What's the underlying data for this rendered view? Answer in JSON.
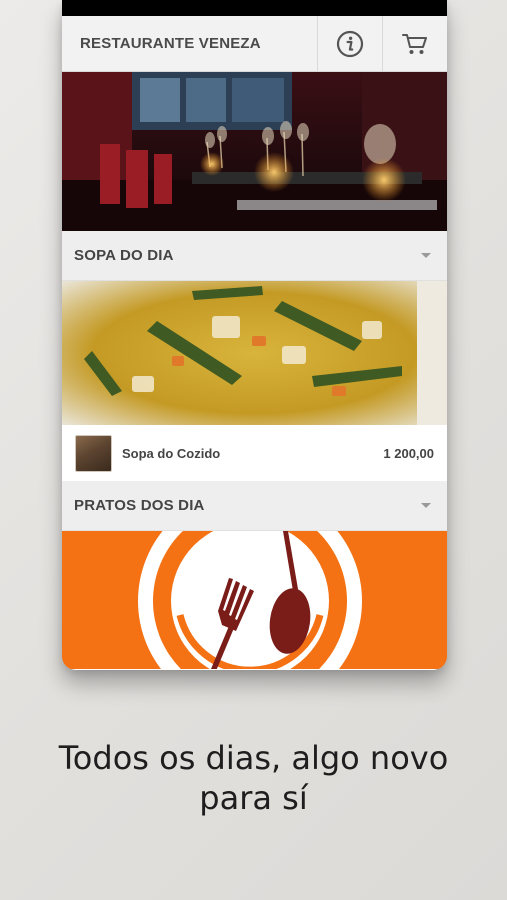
{
  "app": {
    "title": "RESTAURANTE VENEZA",
    "info_icon": "info-icon",
    "cart_icon": "cart-icon"
  },
  "sections": [
    {
      "title": "SOPA DO DIA",
      "items": [
        {
          "name": "Sopa do Cozido",
          "price": "1 200,00"
        }
      ]
    },
    {
      "title": "PRATOS DOS DIA"
    }
  ],
  "tagline": {
    "line1": "Todos os dias, algo novo",
    "line2": "para  sí"
  },
  "colors": {
    "brand_orange": "#f47214",
    "brand_maroon": "#7a1c18",
    "header_bg": "#f2f2f2"
  }
}
